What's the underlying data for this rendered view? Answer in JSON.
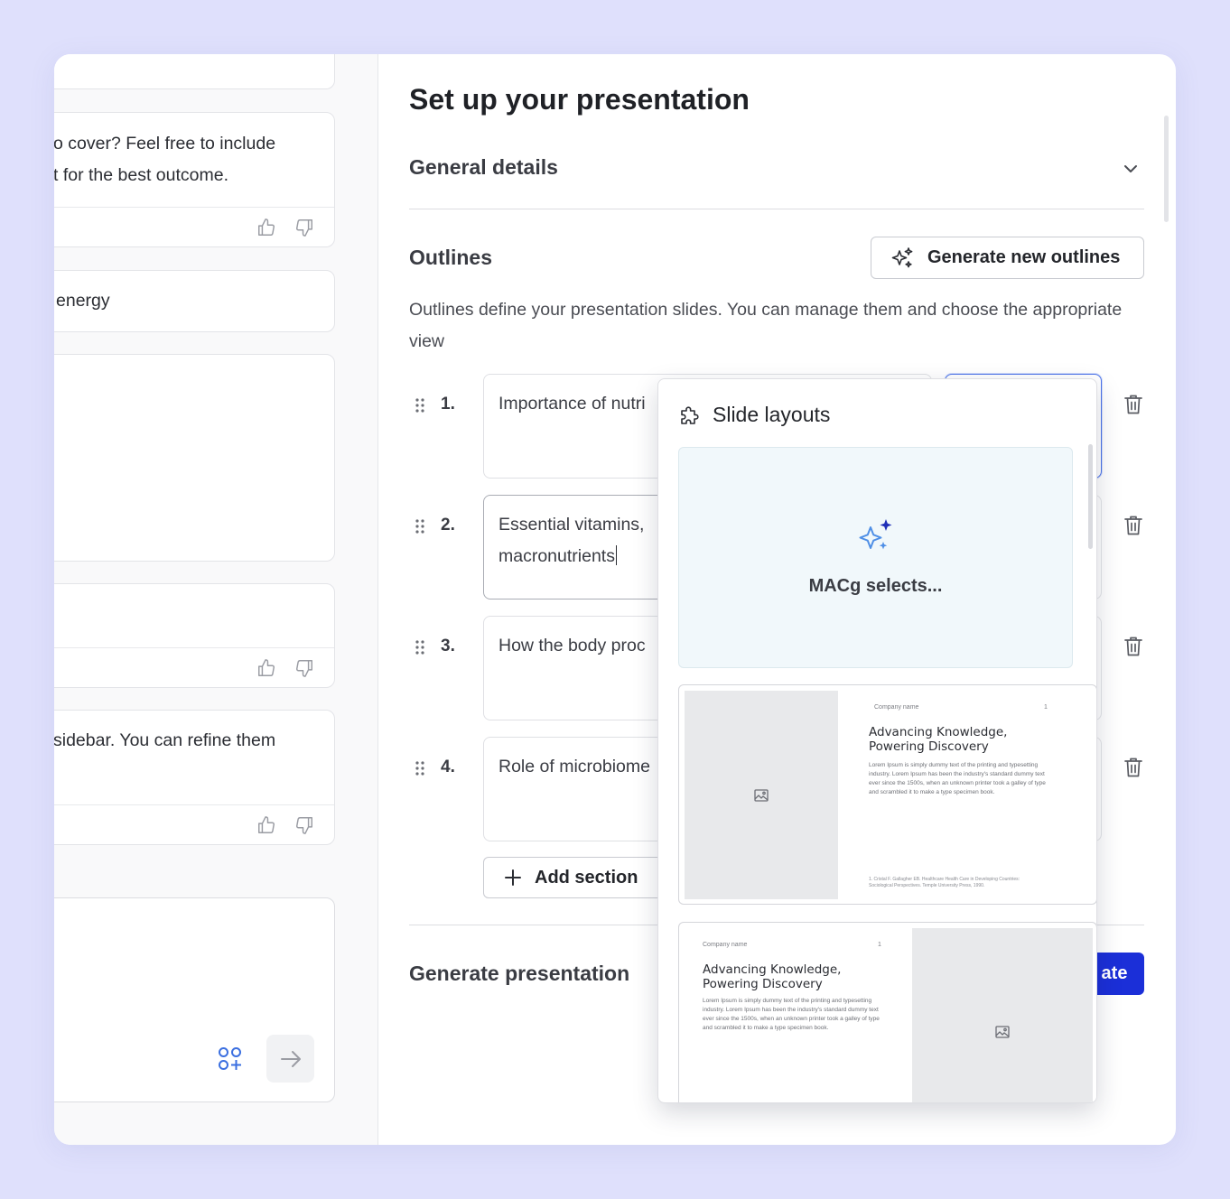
{
  "chat": {
    "messages": [
      {
        "line1": "o cover? Feel free to include",
        "line2": "t for the best outcome."
      },
      {
        "line1": "energy"
      },
      {
        "line1": ""
      },
      {
        "line1": ""
      },
      {
        "line1": "sidebar. You can refine them"
      }
    ]
  },
  "panel": {
    "title": "Set up your presentation",
    "general_details": "General details",
    "outlines_title": "Outlines",
    "generate_outlines_label": "Generate new outlines",
    "description": "Outlines define your presentation slides. You can manage them and choose the appropriate view",
    "outlines": [
      {
        "number": "1.",
        "text": "Importance of nutri"
      },
      {
        "number": "2.",
        "text": "Essential vitamins,",
        "text2": "macronutrients"
      },
      {
        "number": "3.",
        "text": "How the body proc"
      },
      {
        "number": "4.",
        "text": "Role of microbiome"
      }
    ],
    "add_section_label": "Add section",
    "generate_presentation_title": "Generate presentation",
    "generate_button_label": "ate"
  },
  "layouts_popover": {
    "title": "Slide layouts",
    "ai_option_label": "MACg selects...",
    "templates": [
      {
        "company": "Company name",
        "page": "1",
        "heading_line1": "Advancing Knowledge,",
        "heading_line2": "Powering Discovery",
        "body": "Lorem Ipsum is simply dummy text of the printing and typesetting industry. Lorem Ipsum has been the industry's standard dummy text ever since the 1500s, when an unknown printer took a galley of type and scrambled it to make a type specimen book.",
        "footnote": "1. Cristal F. Gallagher EB. Healthcare Health Care in Developing Countries: Sociological Perspectives. Temple University Press, 1990."
      },
      {
        "company": "Company name",
        "page": "1",
        "heading_line1": "Advancing Knowledge,",
        "heading_line2": "Powering Discovery",
        "body": "Lorem Ipsum is simply dummy text of the printing and typesetting industry. Lorem Ipsum has been the industry's standard dummy text ever since the 1500s, when an unknown printer took a galley of type and scrambled it to make a type specimen book."
      }
    ]
  },
  "colors": {
    "background": "#dfe0fc",
    "primary": "#1b2fd8",
    "focus": "#4c73ea",
    "ai_card": "#f1f8fb"
  },
  "icons": {
    "thumbs_up": "thumbs-up-icon",
    "thumbs_down": "thumbs-down-icon",
    "chevron": "chevron-down-icon",
    "sparkle": "sparkle-icon",
    "drag": "drag-handle-icon",
    "trash": "trash-icon",
    "plus": "plus-icon",
    "puzzle": "puzzle-icon",
    "image": "image-icon",
    "apps": "apps-add-icon",
    "arrow": "arrow-right-icon"
  }
}
